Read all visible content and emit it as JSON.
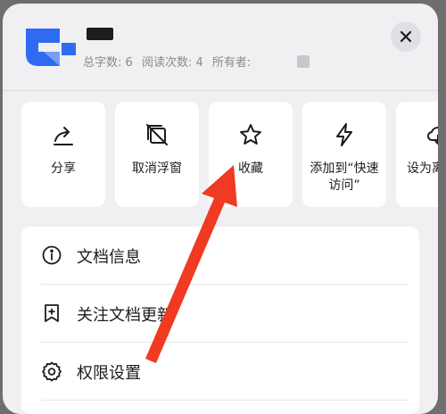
{
  "header": {
    "stats": [
      {
        "label": "总字数: 6"
      },
      {
        "label": "阅读次数: 4"
      },
      {
        "label": "所有者:"
      }
    ]
  },
  "actions": [
    {
      "label": "分享",
      "icon": "share-icon"
    },
    {
      "label": "取消浮窗",
      "icon": "cancel-float-window-icon"
    },
    {
      "label": "收藏",
      "icon": "star-icon"
    },
    {
      "label": "添加到“快速访问”",
      "icon": "lightning-icon"
    },
    {
      "label": "设为离线使",
      "icon": "cloud-icon"
    }
  ],
  "menu": [
    {
      "label": "文档信息",
      "icon": "info-icon"
    },
    {
      "label": "关注文档更新",
      "icon": "bookmark-add-icon"
    },
    {
      "label": "权限设置",
      "icon": "gear-icon"
    }
  ],
  "colors": {
    "brand_blue": "#2f6bf2",
    "annotation_red": "#f03a22"
  }
}
